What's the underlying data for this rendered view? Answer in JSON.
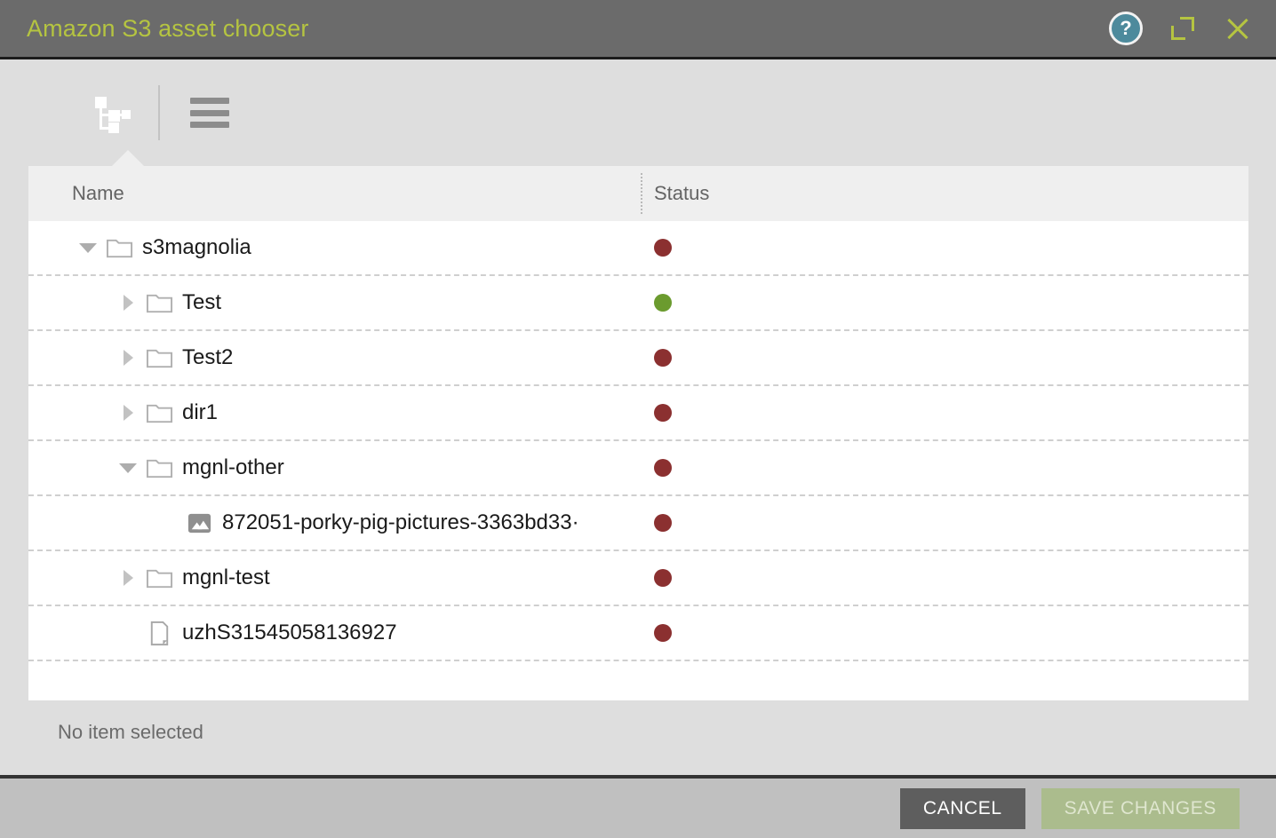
{
  "window": {
    "title": "Amazon S3 asset chooser",
    "actions": {
      "help": "?",
      "help_icon": "help-circle-icon",
      "maximize_icon": "maximize-icon",
      "close_icon": "close-icon"
    }
  },
  "toolbar": {
    "tree_view_icon": "tree-view-icon",
    "list_view_icon": "list-view-icon",
    "active_view": "tree"
  },
  "table": {
    "columns": [
      "Name",
      "Status"
    ],
    "rows": [
      {
        "name": "s3magnolia",
        "icon": "folder-icon",
        "depth": 0,
        "twisty": "expanded",
        "status": "red"
      },
      {
        "name": "Test",
        "icon": "folder-icon",
        "depth": 1,
        "twisty": "collapsed",
        "status": "green"
      },
      {
        "name": "Test2",
        "icon": "folder-icon",
        "depth": 1,
        "twisty": "collapsed",
        "status": "red"
      },
      {
        "name": "dir1",
        "icon": "folder-icon",
        "depth": 1,
        "twisty": "collapsed",
        "status": "red"
      },
      {
        "name": "mgnl-other",
        "icon": "folder-icon",
        "depth": 1,
        "twisty": "expanded",
        "status": "red"
      },
      {
        "name": "872051-porky-pig-pictures-3363bd33·",
        "icon": "image-icon",
        "depth": 2,
        "twisty": "none",
        "status": "red"
      },
      {
        "name": "mgnl-test",
        "icon": "folder-icon",
        "depth": 1,
        "twisty": "collapsed",
        "status": "red"
      },
      {
        "name": "uzhS31545058136927",
        "icon": "document-icon",
        "depth": 1,
        "twisty": "none",
        "status": "red"
      }
    ]
  },
  "selection": {
    "status_text": "No item selected"
  },
  "footer": {
    "cancel_label": "CANCEL",
    "save_label": "SAVE CHANGES",
    "save_disabled": true
  },
  "colors": {
    "accent": "#b5c441",
    "titlebar": "#6b6b6b",
    "background": "#dedede",
    "status_red": "#8b3030",
    "status_green": "#6b9b2e",
    "help_teal": "#4d8a9c",
    "footer": "#c0c0c0",
    "cancel_button": "#5e5e5e",
    "save_button": "#abbc8d"
  }
}
